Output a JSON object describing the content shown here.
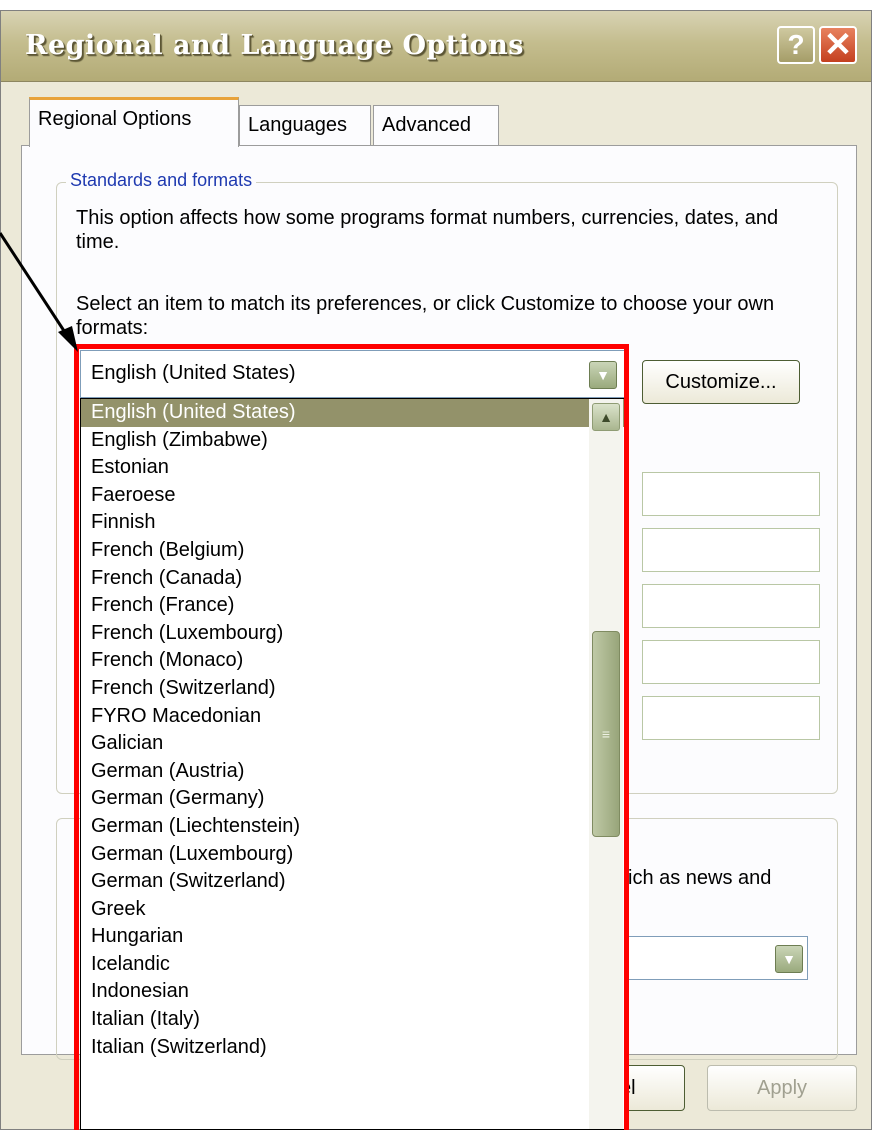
{
  "window": {
    "title": "Regional and Language Options"
  },
  "titlebar_buttons": {
    "help": "?",
    "close": "✕"
  },
  "tabs": [
    {
      "label": "Regional Options",
      "active": true
    },
    {
      "label": "Languages",
      "active": false
    },
    {
      "label": "Advanced",
      "active": false
    }
  ],
  "standards": {
    "group_label": "Standards and formats",
    "description": "This option affects how some programs format numbers, currencies, dates, and time.",
    "select_prompt": "Select an item to match its preferences, or click Customize to choose your own formats:",
    "selected_value": "English (United States)",
    "customize_label": "Customize..."
  },
  "dropdown": {
    "items": [
      "English (United States)",
      "English (Zimbabwe)",
      "Estonian",
      "Faeroese",
      "Finnish",
      "French (Belgium)",
      "French (Canada)",
      "French (France)",
      "French (Luxembourg)",
      "French (Monaco)",
      "French (Switzerland)",
      "FYRO Macedonian",
      "Galician",
      "German (Austria)",
      "German (Germany)",
      "German (Liechtenstein)",
      "German (Luxembourg)",
      "German (Switzerland)",
      "Greek",
      "Hungarian",
      "Icelandic",
      "Indonesian",
      "Italian (Italy)",
      "Italian (Switzerland)"
    ],
    "highlighted_index": 0,
    "scroll_up_icon": "▲",
    "thumb_grip": "≡"
  },
  "location": {
    "partial_text": "ich as news and"
  },
  "footer": {
    "cancel_partial": "el",
    "apply_label": "Apply"
  },
  "colors": {
    "highlight": "#ff0000",
    "selection": "#93926a",
    "title_gradient": "#c4bd8e"
  }
}
